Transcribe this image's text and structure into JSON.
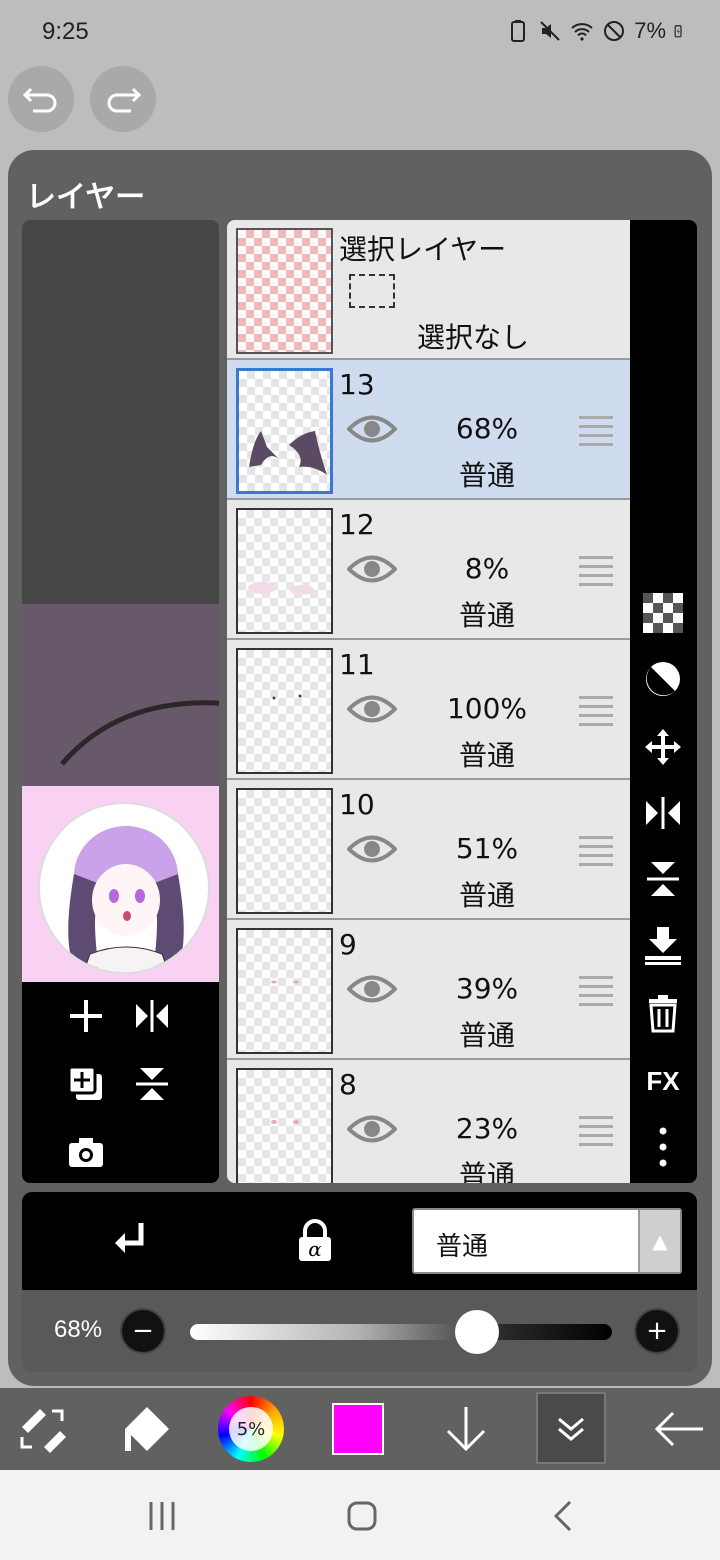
{
  "status_bar": {
    "time": "9:25",
    "battery_percent": "7%"
  },
  "panel": {
    "title": "レイヤー"
  },
  "selection_layer": {
    "title": "選択レイヤー",
    "status": "選択なし"
  },
  "layers": [
    {
      "number": "13",
      "opacity": "68%",
      "blend": "普通",
      "selected": true
    },
    {
      "number": "12",
      "opacity": "8%",
      "blend": "普通",
      "selected": false
    },
    {
      "number": "11",
      "opacity": "100%",
      "blend": "普通",
      "selected": false
    },
    {
      "number": "10",
      "opacity": "51%",
      "blend": "普通",
      "selected": false
    },
    {
      "number": "9",
      "opacity": "39%",
      "blend": "普通",
      "selected": false
    },
    {
      "number": "8",
      "opacity": "23%",
      "blend": "普通",
      "selected": false
    }
  ],
  "side_tools": {
    "fx_label": "FX"
  },
  "blend_bar": {
    "blend_mode": "普通"
  },
  "opacity_bar": {
    "label": "68%",
    "value": 68
  },
  "toolbar": {
    "brush_size_label": "5%",
    "current_color": "#ff00ff"
  },
  "colors": {
    "selected_layer_bg": "#cfdcef",
    "selection_thumb_pattern": "#f5b8b8",
    "panel_bg": "#616161"
  }
}
